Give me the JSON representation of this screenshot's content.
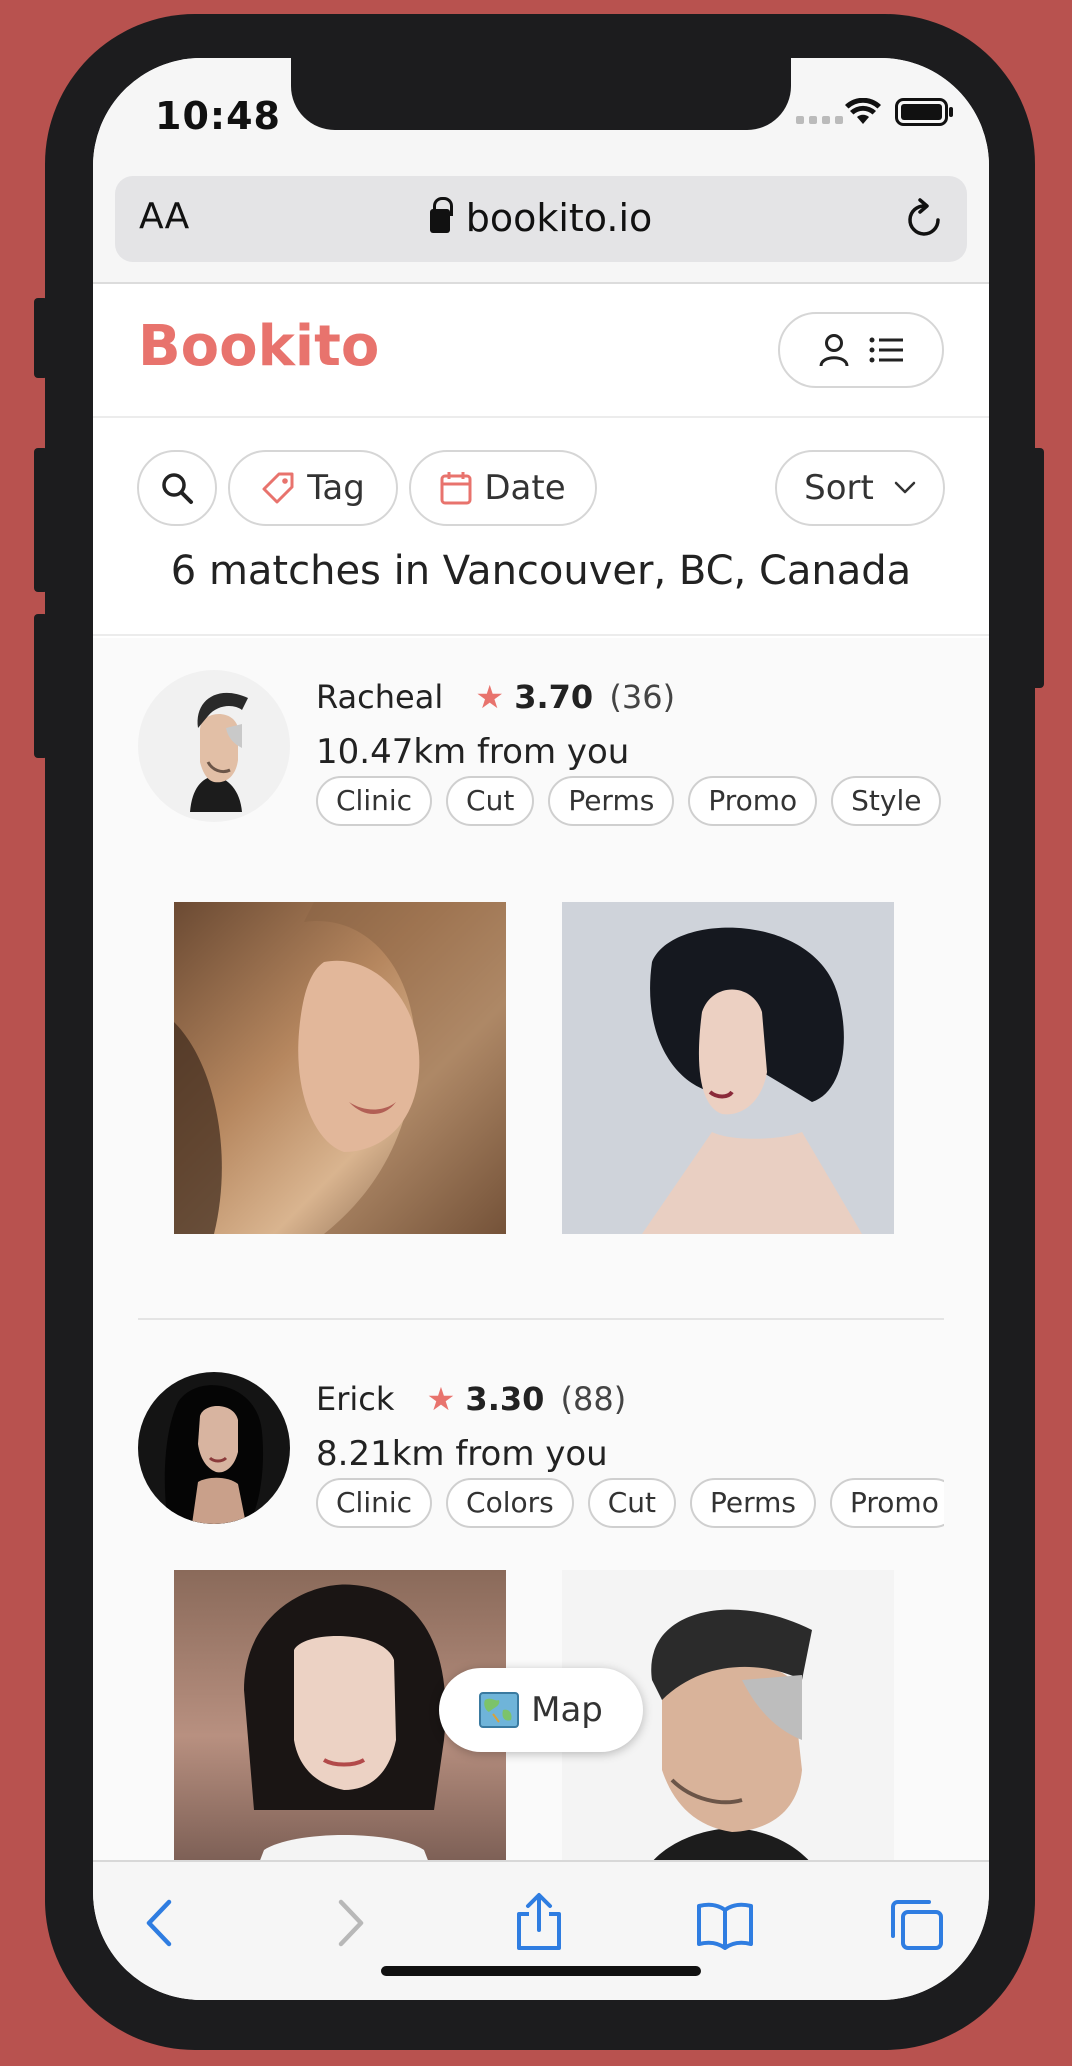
{
  "status_bar": {
    "time": "10:48"
  },
  "browser": {
    "text_size_label": "AA",
    "url": "bookito.io",
    "toolbar": [
      "back",
      "forward",
      "share",
      "bookmarks",
      "tabs"
    ]
  },
  "header": {
    "logo": "Bookito"
  },
  "filters": {
    "tag_label": "Tag",
    "date_label": "Date",
    "sort_label": "Sort",
    "matches_text": "6 matches in Vancouver, BC, Canada"
  },
  "stylists": [
    {
      "name": "Racheal",
      "rating": "3.70",
      "reviews": "(36)",
      "distance": "10.47km from you",
      "tags": [
        "Clinic",
        "Cut",
        "Perms",
        "Promo",
        "Style"
      ]
    },
    {
      "name": "Erick",
      "rating": "3.30",
      "reviews": "(88)",
      "distance": "8.21km from you",
      "tags": [
        "Clinic",
        "Colors",
        "Cut",
        "Perms",
        "Promo"
      ]
    }
  ],
  "map_button": {
    "icon": "map-emoji",
    "label": "Map"
  },
  "colors": {
    "brand": "#e8736d",
    "accent_blue": "#2f7de1",
    "background": "#b8524f"
  }
}
